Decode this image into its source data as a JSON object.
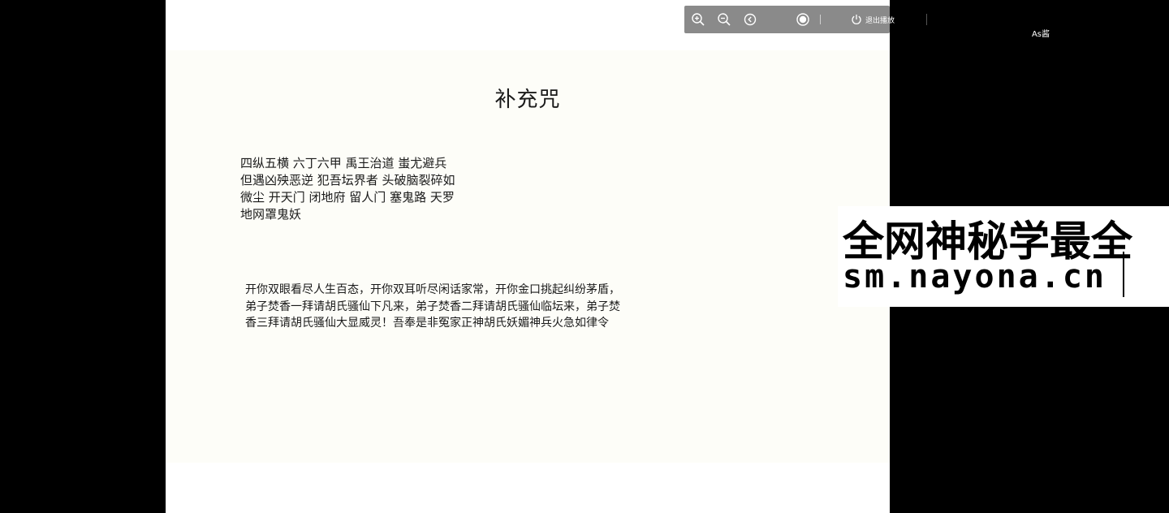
{
  "slide": {
    "title": "补充咒",
    "paragraph1": [
      "四纵五横 六丁六甲 禹王治道 蚩尤避兵",
      "但遇凶殃恶逆 犯吾坛界者 头破脑裂碎如",
      "微尘 开天门 闭地府 留人门 塞鬼路 天罗",
      "地网罩鬼妖"
    ],
    "paragraph2": [
      "开你双眼看尽人生百态，开你双耳听尽闲话家常，开你金口挑起纠纷茅盾，",
      "弟子焚香一拜请胡氏骚仙下凡来，弟子焚香二拜请胡氏骚仙临坛来，弟子焚",
      "香三拜请胡氏骚仙大显威灵！吾奉是非冤家正神胡氏妖媚神兵火急如律令"
    ]
  },
  "toolbar": {
    "zoom_in_icon": "zoom-in-icon",
    "zoom_out_icon": "zoom-out-icon",
    "back_icon": "back-icon",
    "record_icon": "record-icon",
    "exit_icon": "power-icon",
    "exit_label": "退出播放"
  },
  "user": {
    "name": "As酱"
  },
  "watermark": {
    "line1": "全网神秘学最全",
    "line2": "sm.nayona.cn"
  },
  "colors": {
    "background": "#000000",
    "slide": "#ffffff",
    "toolbar": "#8a8a8a",
    "text": "#1a1a1a"
  }
}
